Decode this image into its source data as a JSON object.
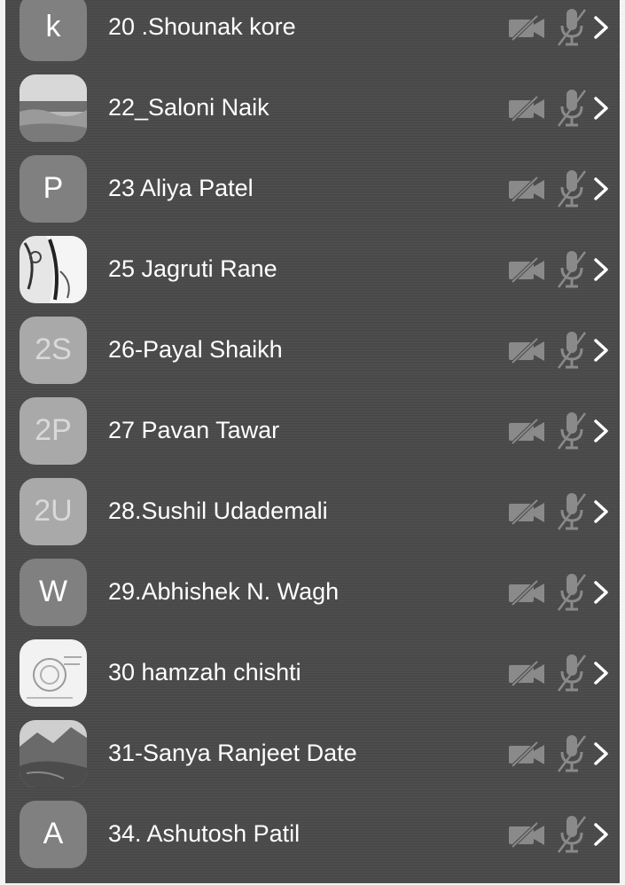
{
  "participants": [
    {
      "label": "20 .Shounak kore",
      "avatar_letter": "k",
      "avatar_type": "letter"
    },
    {
      "label": "22_Saloni Naik",
      "avatar_type": "photo",
      "avatar_desc": "landscape-photo"
    },
    {
      "label": "23 Aliya Patel",
      "avatar_letter": "P",
      "avatar_type": "letter"
    },
    {
      "label": "25 Jagruti Rane",
      "avatar_type": "photo",
      "avatar_desc": "sketch-photo"
    },
    {
      "label": "26-Payal Shaikh",
      "avatar_letter": "2S",
      "avatar_type": "light"
    },
    {
      "label": "27 Pavan Tawar",
      "avatar_letter": "2P",
      "avatar_type": "light"
    },
    {
      "label": "28.Sushil Udademali",
      "avatar_letter": "2U",
      "avatar_type": "light"
    },
    {
      "label": "29.Abhishek N. Wagh",
      "avatar_letter": "W",
      "avatar_type": "letter"
    },
    {
      "label": "30 hamzah chishti",
      "avatar_type": "photo",
      "avatar_desc": "document-photo"
    },
    {
      "label": "31-Sanya Ranjeet Date",
      "avatar_type": "photo",
      "avatar_desc": "mountain-photo"
    },
    {
      "label": "34. Ashutosh Patil",
      "avatar_letter": "A",
      "avatar_type": "letter"
    }
  ],
  "icons": {
    "camera": "video-off-icon",
    "mic": "mic-off-icon",
    "chevron": "chevron-right-icon"
  },
  "colors": {
    "background": "#4a4a4a",
    "text": "#ffffff",
    "avatar_dark": "#808080",
    "avatar_light": "#a9a9a9",
    "icon": "#8a8a8a"
  }
}
